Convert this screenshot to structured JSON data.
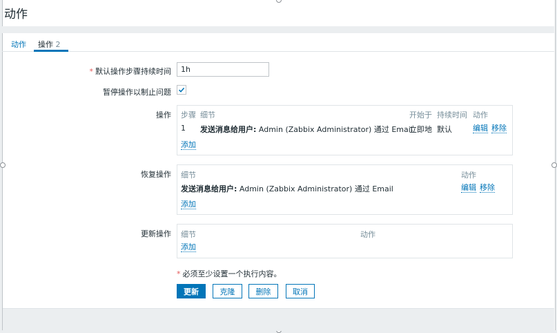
{
  "title": "动作",
  "tabs": [
    {
      "label": "动作"
    },
    {
      "label": "操作",
      "count": "2"
    }
  ],
  "form": {
    "step_duration": {
      "label": "默认操作步骤持续时间",
      "value": "1h"
    },
    "pause_symptoms": {
      "label": "暂停操作以制止问题",
      "checked": true
    },
    "operations": {
      "label": "操作",
      "headers": {
        "steps": "步骤",
        "details": "细节",
        "start_in": "开始于",
        "duration": "持续时间",
        "action": "动作"
      },
      "rows": [
        {
          "step": "1",
          "details_bold": "发送消息给用户:",
          "details_text": " Admin (Zabbix Administrator) 通过 Email",
          "start_in": "立即地",
          "duration": "默认",
          "edit": "编辑",
          "remove": "移除"
        }
      ],
      "add": "添加"
    },
    "recovery": {
      "label": "恢复操作",
      "headers": {
        "details": "细节",
        "action": "动作"
      },
      "rows": [
        {
          "details_bold": "发送消息给用户:",
          "details_text": " Admin (Zabbix Administrator) 通过 Email",
          "edit": "编辑",
          "remove": "移除"
        }
      ],
      "add": "添加"
    },
    "update": {
      "label": "更新操作",
      "headers": {
        "details": "细节",
        "action": "动作"
      },
      "add": "添加"
    },
    "required_note": "必须至少设置一个执行内容。"
  },
  "buttons": {
    "update": "更新",
    "clone": "克隆",
    "delete": "删除",
    "cancel": "取消"
  },
  "colors": {
    "accent": "#0275b8",
    "required": "#e45959",
    "muted": "#768d99"
  }
}
